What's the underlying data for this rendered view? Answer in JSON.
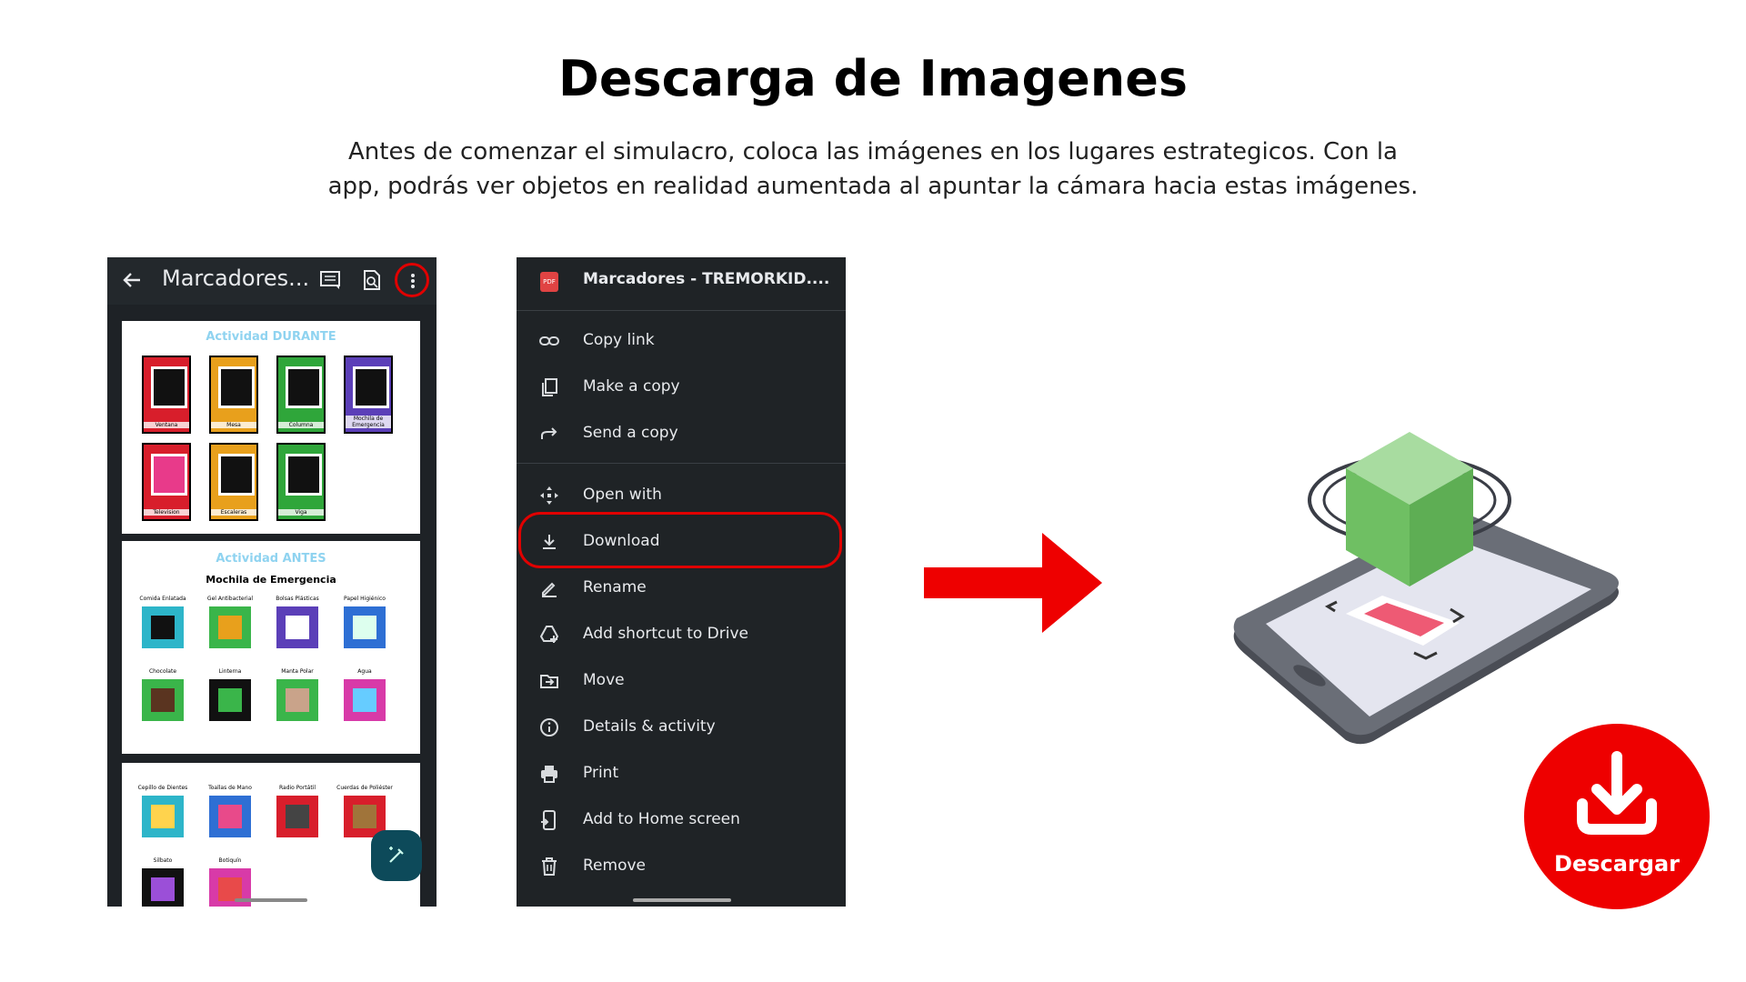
{
  "header": {
    "title": "Descarga de Imagenes",
    "description": "Antes de comenzar el simulacro, coloca las imágenes en los lugares estrategicos. Con la app, podrás ver objetos en realidad aumentada al apuntar la cámara hacia estas imágenes."
  },
  "viewer": {
    "title": "Marcadores...",
    "pages": [
      {
        "title": "Actividad DURANTE",
        "cards": [
          {
            "label": "Ventana",
            "color": "#d81e2b"
          },
          {
            "label": "Mesa",
            "color": "#e8a01c"
          },
          {
            "label": "Columna",
            "color": "#2fa63a"
          },
          {
            "label": "Mochila de Emergencia",
            "color": "#5b3fb8"
          },
          {
            "label": "Television",
            "color": "#d81e2b"
          },
          {
            "label": "Escaleras",
            "color": "#e8a01c"
          },
          {
            "label": "Viga",
            "color": "#2fa63a"
          }
        ]
      },
      {
        "title": "Actividad ANTES",
        "subtitle": "Mochila de Emergencia",
        "items": [
          {
            "label": "Comida Enlatada",
            "color": "#2db5c9"
          },
          {
            "label": "Gel Antibacterial",
            "color": "#3ab54a"
          },
          {
            "label": "Bolsas Plásticas",
            "color": "#5b3fb8"
          },
          {
            "label": "Papel Higiénico",
            "color": "#2e6fd4"
          },
          {
            "label": "Chocolate",
            "color": "#3ab54a"
          },
          {
            "label": "Linterna",
            "color": "#111111"
          },
          {
            "label": "Manta Polar",
            "color": "#3ab54a"
          },
          {
            "label": "Agua",
            "color": "#d83aa8"
          }
        ]
      },
      {
        "items": [
          {
            "label": "Cepillo de Dientes",
            "color": "#2db5c9"
          },
          {
            "label": "Toallas de Mano",
            "color": "#2e6fd4"
          },
          {
            "label": "Radio Portátil",
            "color": "#d81e2b"
          },
          {
            "label": "Cuerdas de Poliéster",
            "color": "#d81e2b"
          },
          {
            "label": "Silbato",
            "color": "#111111"
          },
          {
            "label": "Botiquín",
            "color": "#d83aa8"
          }
        ]
      }
    ]
  },
  "menu": {
    "file_icon": "PDF",
    "file_title": "Marcadores - TREMORKID....",
    "items": [
      {
        "label": "Copy link",
        "icon": "link-icon"
      },
      {
        "label": "Make a copy",
        "icon": "copy-icon"
      },
      {
        "label": "Send a copy",
        "icon": "share-icon"
      },
      {
        "label": "Open with",
        "icon": "open-with-icon"
      },
      {
        "label": "Download",
        "icon": "download-icon"
      },
      {
        "label": "Rename",
        "icon": "pencil-icon"
      },
      {
        "label": "Add shortcut to Drive",
        "icon": "drive-shortcut-icon"
      },
      {
        "label": "Move",
        "icon": "move-folder-icon"
      },
      {
        "label": "Details & activity",
        "icon": "info-icon"
      },
      {
        "label": "Print",
        "icon": "print-icon"
      },
      {
        "label": "Add to Home screen",
        "icon": "home-screen-icon"
      },
      {
        "label": "Remove",
        "icon": "trash-icon"
      }
    ]
  },
  "download_button": {
    "label": "Descargar"
  },
  "colors": {
    "accent": "#ee0000",
    "cube": "#7cc66e",
    "marker": "#ee5a74",
    "phone_body": "#55585f"
  }
}
